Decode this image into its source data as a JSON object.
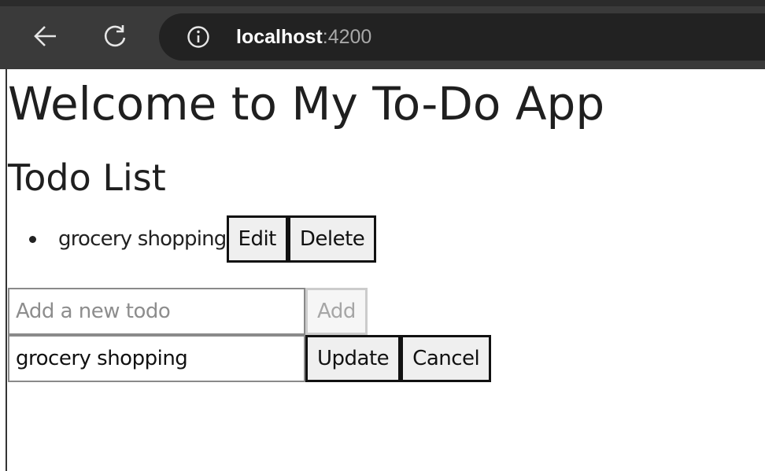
{
  "browser": {
    "url_host": "localhost",
    "url_port": ":4200",
    "back_icon": "arrow-left-icon",
    "reload_icon": "reload-icon",
    "info_icon": "info-icon"
  },
  "app": {
    "title": "Welcome to My To-Do App",
    "list_title": "Todo List",
    "todos": [
      {
        "text": "grocery shopping",
        "edit_label": "Edit",
        "delete_label": "Delete"
      }
    ],
    "add_form": {
      "placeholder": "Add a new todo",
      "value": "",
      "add_label": "Add",
      "add_disabled": true
    },
    "edit_form": {
      "value": "grocery shopping",
      "update_label": "Update",
      "cancel_label": "Cancel"
    }
  }
}
